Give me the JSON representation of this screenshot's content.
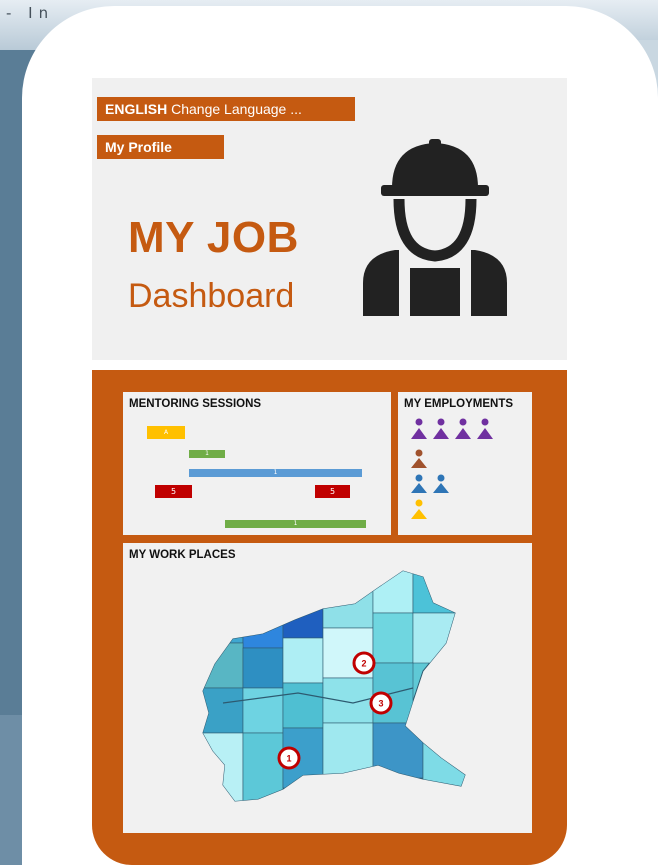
{
  "background": {
    "fragment_text": "- In"
  },
  "header": {
    "language_label_bold": "ENGLISH",
    "language_label_rest": " Change Language ...",
    "profile_label": "My Profile",
    "title": "MY JOB",
    "subtitle": "Dashboard",
    "worker_icon": "construction-worker-icon"
  },
  "mentoring": {
    "title": "MENTORING SESSIONS",
    "bars": [
      {
        "label": "A",
        "color": "#ffc000"
      },
      {
        "label": "1",
        "color": "#70ad47"
      },
      {
        "label": "1",
        "color": "#5b9bd5"
      },
      {
        "label": "5",
        "color": "#c00000"
      },
      {
        "label": "5",
        "color": "#c00000"
      },
      {
        "label": "1",
        "color": "#70ad47"
      }
    ]
  },
  "employments": {
    "title": "MY EMPLOYMENTS",
    "icon": "person-icon",
    "colors": {
      "purple": "#7030a0",
      "brown": "#a0522d",
      "blue": "#2e75b6",
      "yellow": "#ffc000"
    }
  },
  "workplaces": {
    "title": "MY WORK PLACES",
    "markers": [
      "2",
      "3",
      "1"
    ]
  },
  "colors": {
    "accent": "#c55a11",
    "panel": "#f0f0f0"
  }
}
